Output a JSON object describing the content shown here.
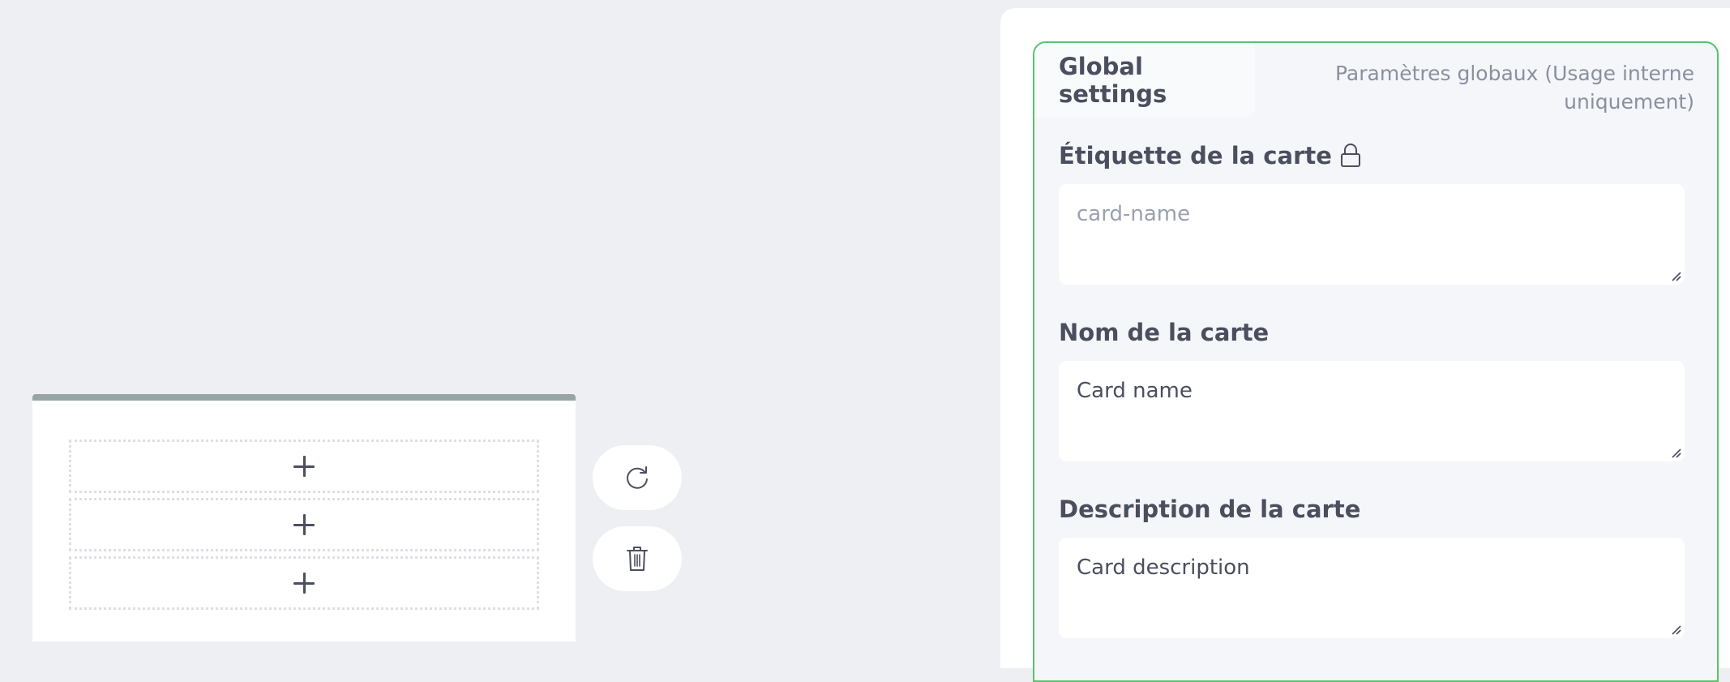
{
  "card_preview": {
    "slots": [
      {
        "icon": "plus-icon"
      },
      {
        "icon": "plus-icon"
      },
      {
        "icon": "plus-icon"
      }
    ]
  },
  "actions": {
    "refresh_icon": "refresh-icon",
    "delete_icon": "trash-icon"
  },
  "settings": {
    "tab_label": "Global settings",
    "note": "Paramètres globaux (Usage interne uniquement)",
    "fields": [
      {
        "label": "Étiquette de la carte",
        "locked": true,
        "value": "",
        "placeholder": "card-name"
      },
      {
        "label": "Nom de la carte",
        "locked": false,
        "value": "Card name",
        "placeholder": ""
      },
      {
        "label": "Description de la carte",
        "locked": false,
        "value": "Card description",
        "placeholder": ""
      }
    ]
  },
  "colors": {
    "background": "#edeff3",
    "panel": "#ffffff",
    "accent_border": "#59c26b",
    "card_top_bar": "#98a5a5",
    "text": "#4a4e5e",
    "muted_text": "#8b90a0"
  }
}
